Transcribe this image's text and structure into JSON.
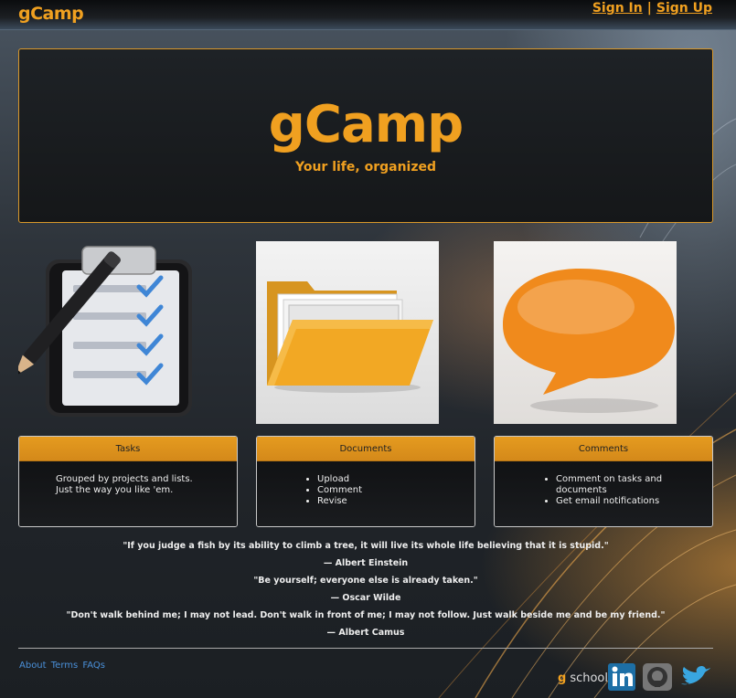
{
  "navbar": {
    "brand": "gCamp",
    "sign_in": "Sign In",
    "separator": "|",
    "sign_up": "Sign Up"
  },
  "hero": {
    "title": "gCamp",
    "subtitle": "Your life, organized"
  },
  "images": [
    {
      "icon": "clipboard-checklist-icon"
    },
    {
      "icon": "folder-icon"
    },
    {
      "icon": "speech-bubble-icon"
    }
  ],
  "cards": {
    "tasks": {
      "title": "Tasks",
      "text": "Grouped by projects and lists. Just the way you like 'em."
    },
    "documents": {
      "title": "Documents",
      "items": [
        "Upload",
        "Comment",
        "Revise"
      ]
    },
    "comments": {
      "title": "Comments",
      "items": [
        "Comment on tasks and documents",
        "Get email notifications"
      ]
    }
  },
  "quotes": [
    {
      "text": "\"If you judge a fish by its ability to climb a tree, it will live its whole life believing that it is stupid.\"",
      "author": "— Albert Einstein"
    },
    {
      "text": "\"Be yourself; everyone else is already taken.\"",
      "author": "— Oscar Wilde"
    },
    {
      "text": "\"Don't walk behind me; I may not lead. Don't walk in front of me; I may not follow. Just walk beside me and be my friend.\"",
      "author": "— Albert Camus"
    }
  ],
  "footer": {
    "links": [
      "About",
      "Terms",
      "FAQs"
    ],
    "brand_mark": "g",
    "brand_text": "school",
    "social": [
      "linkedin-icon",
      "github-icon",
      "twitter-icon"
    ]
  },
  "colors": {
    "accent": "#f0a020",
    "card_header": "#e09a22",
    "link": "#4a90d9"
  }
}
